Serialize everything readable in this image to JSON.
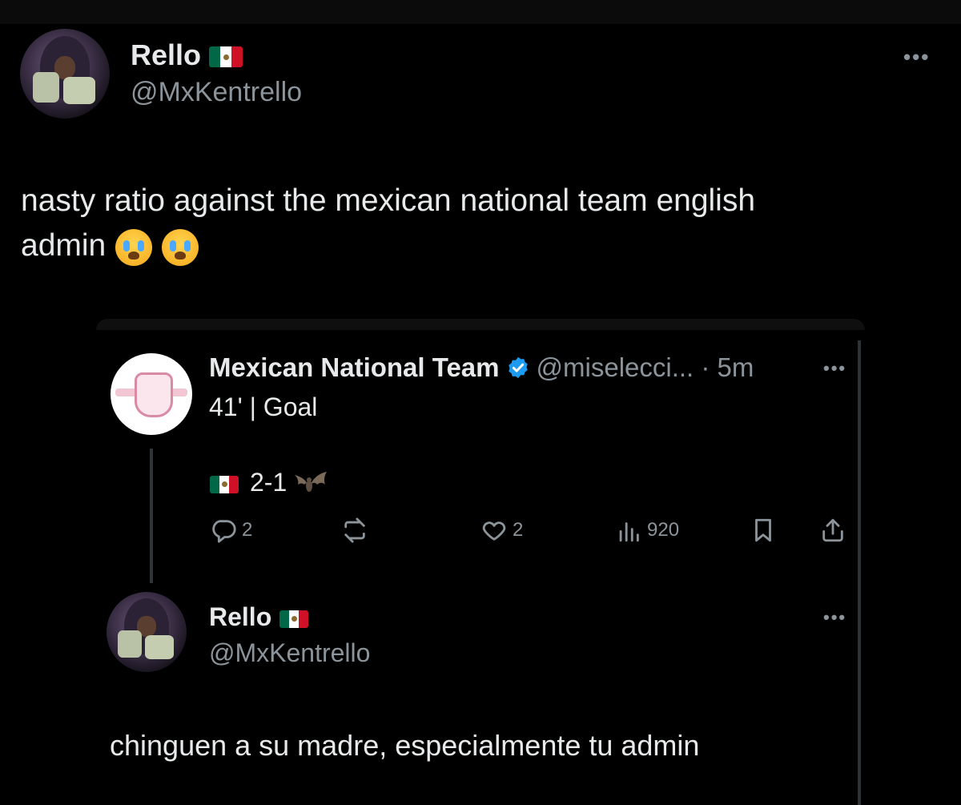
{
  "main_tweet": {
    "display_name": "Rello",
    "handle": "@MxKentrello",
    "text_line1": "nasty ratio against the mexican national team english",
    "text_line2": "admin"
  },
  "quoted_tweet": {
    "display_name": "Mexican National Team",
    "handle_time": "@miselecci... · 5m",
    "text": "41' | Goal",
    "score": "2-1",
    "actions": {
      "replies": "2",
      "likes": "2",
      "views": "920"
    }
  },
  "reply_tweet": {
    "display_name": "Rello",
    "handle": "@MxKentrello",
    "text": "chinguen a su madre, especialmente tu admin"
  },
  "icons": {
    "more": "•••",
    "verified_color": "#1d9bf0"
  }
}
